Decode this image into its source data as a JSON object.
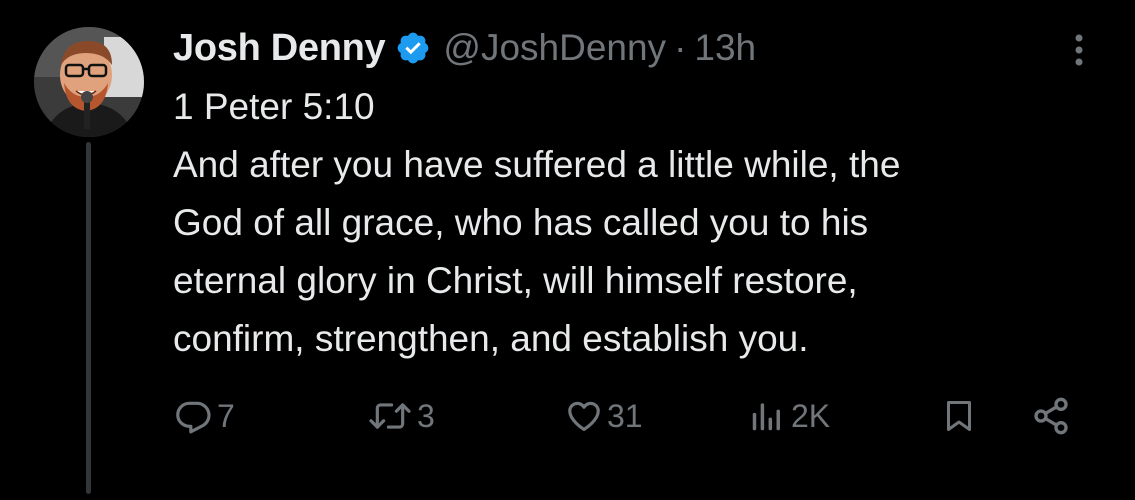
{
  "author": {
    "display_name": "Josh Denny",
    "handle": "@JoshDenny",
    "separator": "·",
    "time": "13h",
    "verified": true
  },
  "tweet": {
    "lines": [
      "1 Peter 5:10",
      "And after you have suffered a little while, the",
      "God of all grace, who has called you to his",
      "eternal glory in Christ, will himself restore,",
      "confirm, strengthen, and establish you."
    ]
  },
  "actions": {
    "replies": "7",
    "reposts": "3",
    "likes": "31",
    "views": "2K"
  },
  "icons": {
    "verified": "verified-badge-icon",
    "more": "more-vertical-icon",
    "reply": "reply-icon",
    "repost": "repost-icon",
    "like": "heart-icon",
    "views": "views-bar-chart-icon",
    "bookmark": "bookmark-icon",
    "share": "share-icon"
  },
  "colors": {
    "background": "#000000",
    "text_primary": "#e7e9ea",
    "text_secondary": "#71767b",
    "verified_blue": "#1d9bf0",
    "thread_line": "#333639"
  }
}
